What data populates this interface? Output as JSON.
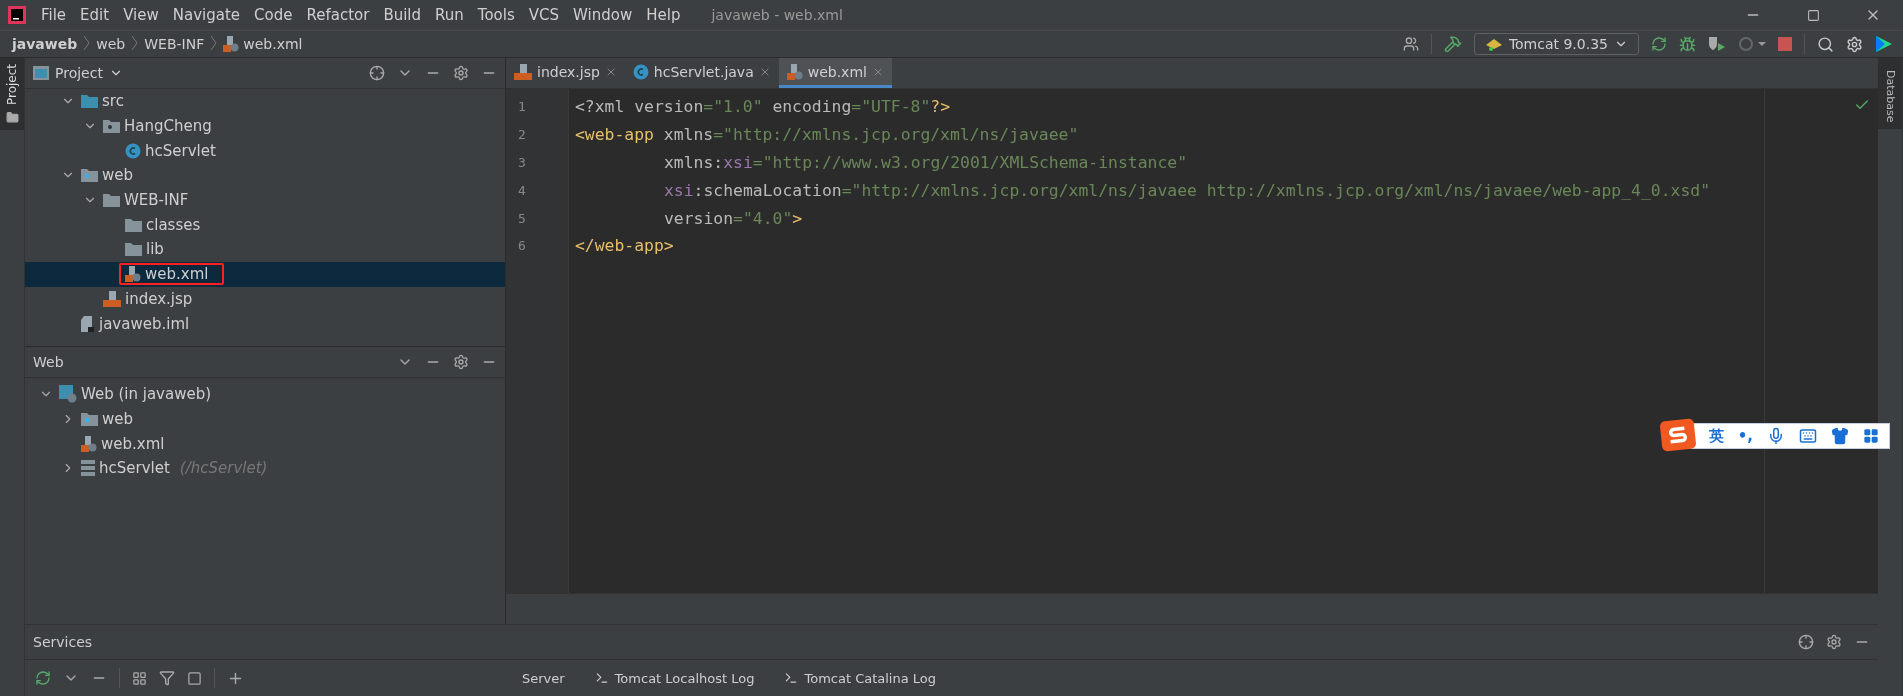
{
  "menu": [
    "File",
    "Edit",
    "View",
    "Navigate",
    "Code",
    "Refactor",
    "Build",
    "Run",
    "Tools",
    "VCS",
    "Window",
    "Help"
  ],
  "window": {
    "title": "javaweb - web.xml"
  },
  "breadcrumb": [
    {
      "label": "javaweb",
      "kind": "project"
    },
    {
      "label": "web",
      "kind": "folder"
    },
    {
      "label": "WEB-INF",
      "kind": "folder"
    },
    {
      "label": "web.xml",
      "kind": "xml"
    }
  ],
  "run_config": {
    "label": "Tomcat 9.0.35"
  },
  "left_stripe": {
    "label": "Project"
  },
  "right_stripe": {
    "label": "Database"
  },
  "project_panel": {
    "title": "Project",
    "tree": [
      {
        "label": "src",
        "kind": "source-folder",
        "expanded": true,
        "selected": false,
        "children": [
          {
            "label": "HangCheng",
            "kind": "package",
            "expanded": true,
            "selected": false,
            "children": [
              {
                "label": "hcServlet",
                "kind": "class",
                "selected": false
              }
            ]
          }
        ]
      },
      {
        "label": "web",
        "kind": "web-folder",
        "expanded": true,
        "selected": false,
        "children": [
          {
            "label": "WEB-INF",
            "kind": "folder",
            "expanded": true,
            "selected": false,
            "children": [
              {
                "label": "classes",
                "kind": "folder",
                "selected": false
              },
              {
                "label": "lib",
                "kind": "folder",
                "selected": false
              },
              {
                "label": "web.xml",
                "kind": "xml",
                "selected": true,
                "highlighted": true
              }
            ]
          },
          {
            "label": "index.jsp",
            "kind": "jsp",
            "selected": false
          }
        ]
      },
      {
        "label": "javaweb.iml",
        "kind": "iml",
        "selected": false
      }
    ]
  },
  "web_panel": {
    "title": "Web",
    "tree": [
      {
        "label": "Web (in javaweb)",
        "kind": "web-facet",
        "expanded": true,
        "selected": false,
        "children": [
          {
            "label": "web",
            "kind": "web-folder",
            "expanded": false,
            "selected": false
          },
          {
            "label": "web.xml",
            "kind": "xml",
            "selected": false
          },
          {
            "label": "hcServlet",
            "hint": "(/hcServlet)",
            "kind": "servlet",
            "expanded": false,
            "selected": false
          }
        ]
      }
    ]
  },
  "editor_tabs": [
    {
      "label": "index.jsp",
      "kind": "jsp",
      "selected": false
    },
    {
      "label": "hcServlet.java",
      "kind": "class",
      "selected": false
    },
    {
      "label": "web.xml",
      "kind": "xml",
      "selected": true
    }
  ],
  "code": [
    {
      "number": "1",
      "tokens": [
        {
          "text": "<?xml ",
          "kind": "plain"
        },
        {
          "text": "version",
          "kind": "plain"
        },
        {
          "text": "=\"1.0\" ",
          "kind": "value"
        },
        {
          "text": "encoding",
          "kind": "plain"
        },
        {
          "text": "=\"UTF-8\"",
          "kind": "value"
        },
        {
          "text": "?>",
          "kind": "tag"
        }
      ]
    },
    {
      "number": "2",
      "tokens": [
        {
          "text": "<web-app ",
          "kind": "tag"
        },
        {
          "text": "xmlns",
          "kind": "plain"
        },
        {
          "text": "=\"http://xmlns.jcp.org/xml/ns/javaee\"",
          "kind": "value"
        }
      ]
    },
    {
      "number": "3",
      "indented": true,
      "tokens": [
        {
          "text": "xmlns:",
          "kind": "plain"
        },
        {
          "text": "xsi",
          "kind": "ns"
        },
        {
          "text": "=\"http://www.w3.org/2001/XMLSchema-instance\"",
          "kind": "value"
        }
      ]
    },
    {
      "number": "4",
      "indented": true,
      "tokens": [
        {
          "text": "xsi",
          "kind": "ns"
        },
        {
          "text": ":schemaLocation",
          "kind": "plain"
        },
        {
          "text": "=\"http://xmlns.jcp.org/xml/ns/javaee http://xmlns.jcp.org/xml/ns/javaee/web-app_4_0.xsd\"",
          "kind": "value"
        }
      ]
    },
    {
      "number": "5",
      "indented": true,
      "tokens": [
        {
          "text": "version",
          "kind": "plain"
        },
        {
          "text": "=\"4.0\"",
          "kind": "value"
        },
        {
          "text": ">",
          "kind": "tag"
        }
      ]
    },
    {
      "number": "6",
      "tokens": [
        {
          "text": "</web-app>",
          "kind": "tag"
        }
      ]
    }
  ],
  "services": {
    "title": "Services",
    "tabs": [
      "Server",
      "Tomcat Localhost Log",
      "Tomcat Catalina Log"
    ]
  },
  "ime_bar": {
    "mode": "英",
    "punct": "•,"
  }
}
